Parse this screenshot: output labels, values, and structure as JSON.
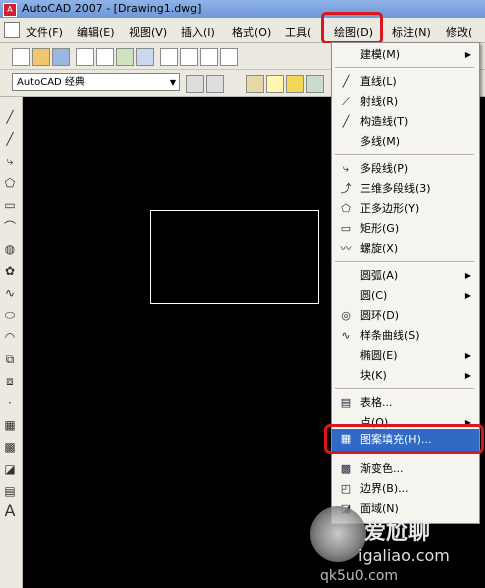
{
  "window": {
    "app_icon": "A",
    "title": "AutoCAD 2007 - [Drawing1.dwg]"
  },
  "menubar": {
    "items": [
      "文件(F)",
      "编辑(E)",
      "视图(V)",
      "插入(I)",
      "格式(O)",
      "工具(",
      "绘图(D)",
      "标注(N)",
      "修改("
    ]
  },
  "toolbar": {
    "workspace_combo": "AutoCAD 经典"
  },
  "draw_menu": {
    "items": [
      {
        "label": "建模(M)",
        "icon": "",
        "submenu": true
      },
      {
        "label": "直线(L)",
        "icon": "line-icon",
        "submenu": false
      },
      {
        "label": "射线(R)",
        "icon": "ray-icon",
        "submenu": false
      },
      {
        "label": "构造线(T)",
        "icon": "construction-line-icon",
        "submenu": false
      },
      {
        "label": "多线(M)",
        "icon": "",
        "submenu": false
      },
      {
        "label": "多段线(P)",
        "icon": "polyline-icon",
        "submenu": false
      },
      {
        "label": "三维多段线(3)",
        "icon": "3d-polyline-icon",
        "submenu": false
      },
      {
        "label": "正多边形(Y)",
        "icon": "polygon-icon",
        "submenu": false
      },
      {
        "label": "矩形(G)",
        "icon": "rectangle-icon",
        "submenu": false
      },
      {
        "label": "螺旋(X)",
        "icon": "helix-icon",
        "submenu": false
      },
      {
        "label": "圆弧(A)",
        "icon": "",
        "submenu": true
      },
      {
        "label": "圆(C)",
        "icon": "",
        "submenu": true
      },
      {
        "label": "圆环(D)",
        "icon": "donut-icon",
        "submenu": false
      },
      {
        "label": "样条曲线(S)",
        "icon": "spline-icon",
        "submenu": false
      },
      {
        "label": "椭圆(E)",
        "icon": "",
        "submenu": true
      },
      {
        "label": "块(K)",
        "icon": "",
        "submenu": true
      },
      {
        "label": "表格...",
        "icon": "table-icon",
        "submenu": false
      },
      {
        "label": "点(O)",
        "icon": "",
        "submenu": true
      },
      {
        "label": "图案填充(H)...",
        "icon": "hatch-icon",
        "submenu": false
      },
      {
        "label": "渐变色...",
        "icon": "gradient-icon",
        "submenu": false
      },
      {
        "label": "边界(B)...",
        "icon": "boundary-icon",
        "submenu": false
      },
      {
        "label": "面域(N)",
        "icon": "region-icon",
        "submenu": false
      }
    ],
    "highlighted_index": 18
  },
  "annotation_color": "#d9171d",
  "highlight_color": "#316ac5",
  "watermark": {
    "brand": "爱尬聊",
    "domain": "igaliao.com",
    "sub": "qk5u0.com"
  }
}
